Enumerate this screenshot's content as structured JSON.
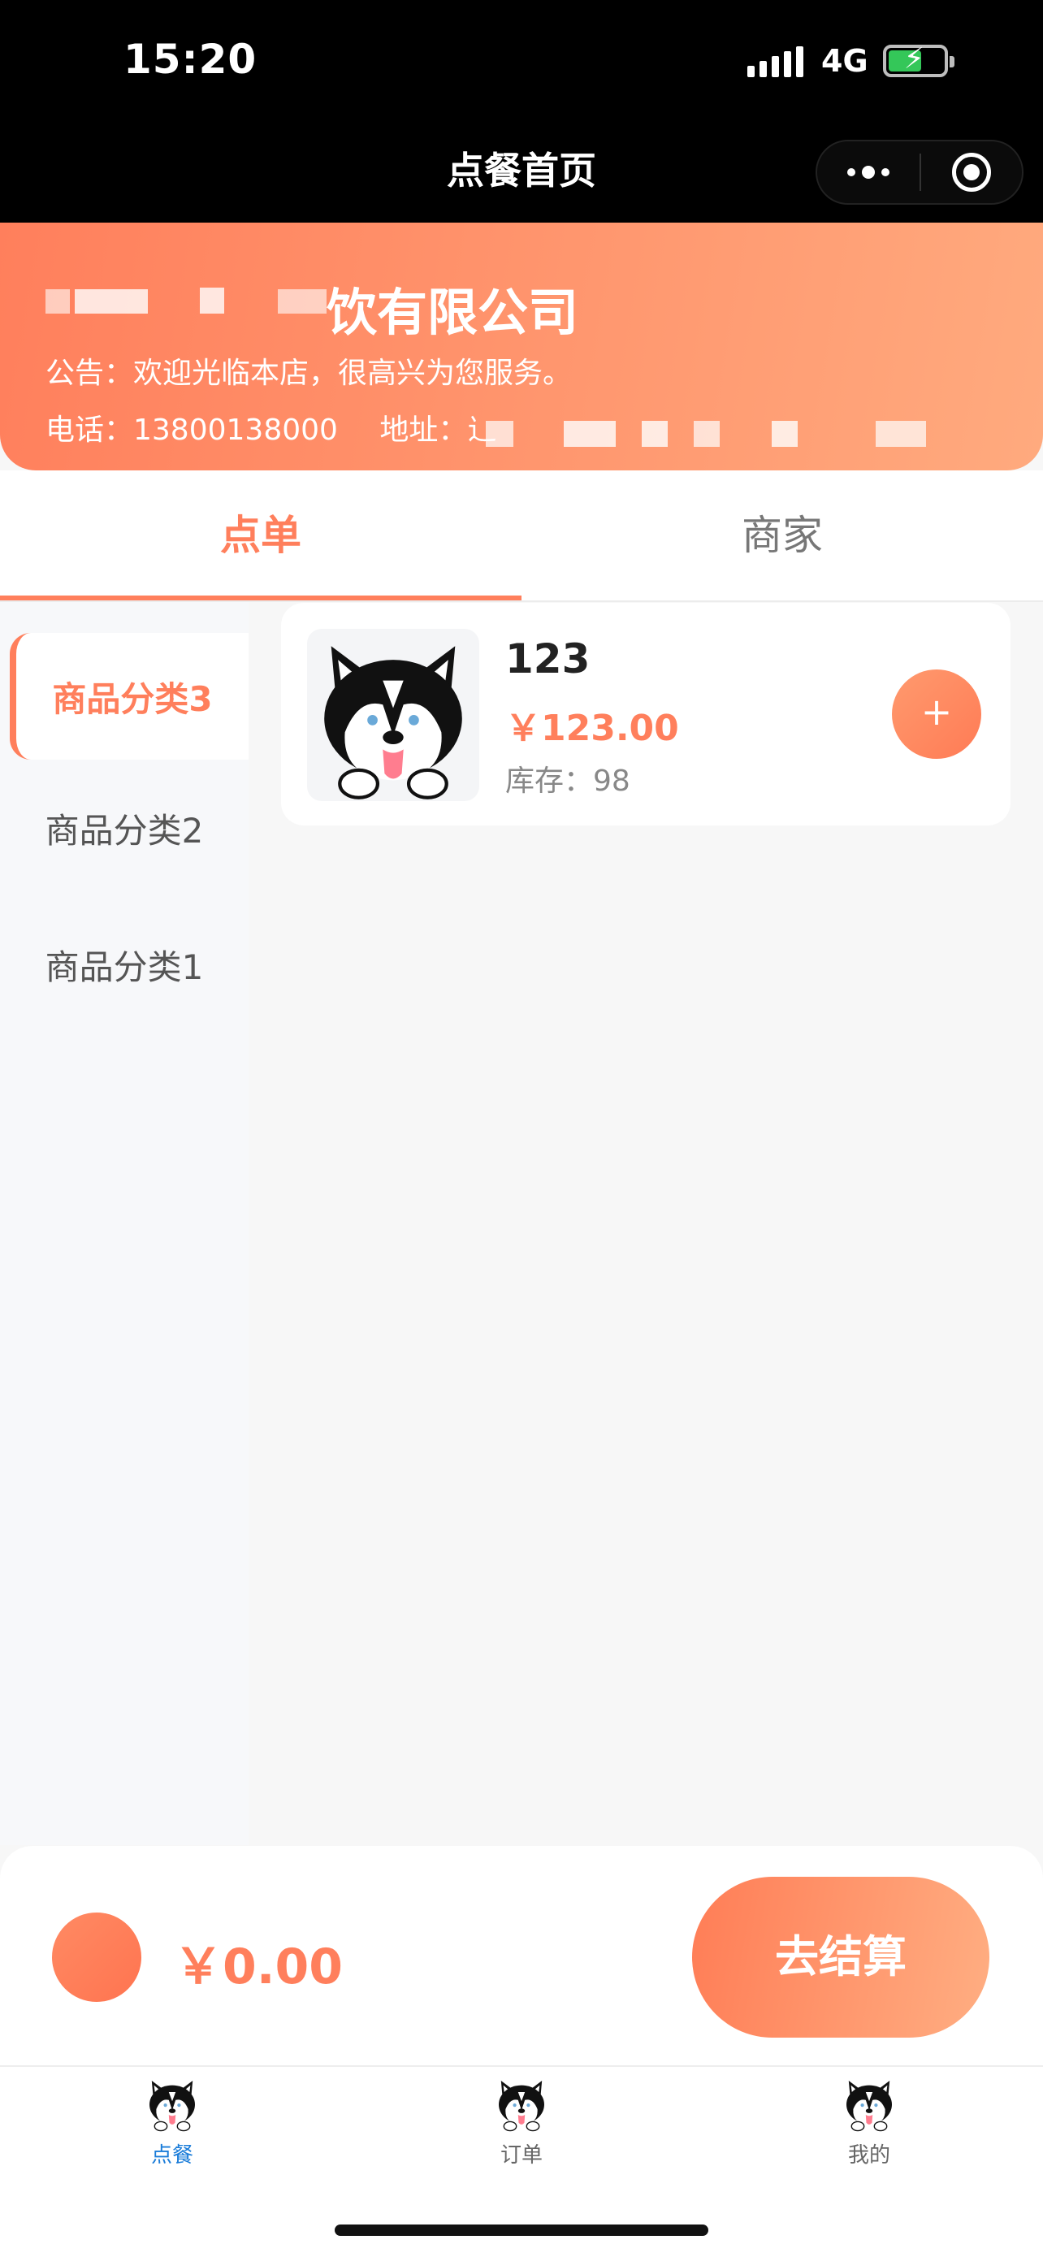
{
  "status_bar": {
    "time": "15:20",
    "network": "4G"
  },
  "nav": {
    "title": "点餐首页"
  },
  "store": {
    "name": "饮有限公司",
    "notice": "公告：欢迎光临本店，很高兴为您服务。",
    "phone": "电话：13800138000",
    "address": "地址：辶"
  },
  "tabs": [
    {
      "label": "点单"
    },
    {
      "label": "商家"
    }
  ],
  "categories": [
    {
      "label": "商品分类3"
    },
    {
      "label": "商品分类2"
    },
    {
      "label": "商品分类1"
    }
  ],
  "products": [
    {
      "name": "123",
      "price": "￥123.00",
      "stock": "库存：98",
      "add_label": "+"
    }
  ],
  "cart": {
    "total": "￥0.00",
    "checkout_label": "去结算"
  },
  "tabbar": [
    {
      "label": "点餐"
    },
    {
      "label": "订单"
    },
    {
      "label": "我的"
    }
  ],
  "colors": {
    "accent": "#ff7f5c",
    "active_tab_label": "#1a7cd9",
    "header_bg": "#000000"
  }
}
